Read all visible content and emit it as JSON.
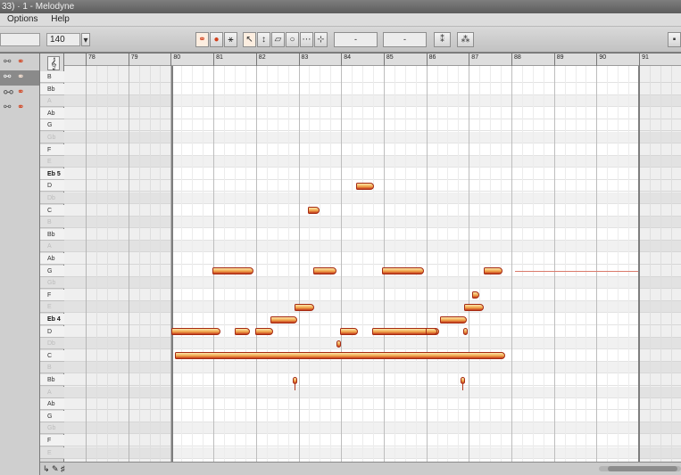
{
  "window": {
    "title": "33) · 1 - Melodyne"
  },
  "menu": {
    "items": [
      "Options",
      "Help"
    ]
  },
  "toolbar": {
    "tempo_value": "140",
    "tempo_step": "▾",
    "field_a": "-",
    "field_b": "-"
  },
  "sidebar": {
    "link_icon": "⚯",
    "note_icon": "⚭"
  },
  "piano_keys": [
    {
      "label": "B",
      "black": false,
      "bold": false
    },
    {
      "label": "Bb",
      "black": false,
      "bold": false
    },
    {
      "label": "A",
      "black": true,
      "bold": false
    },
    {
      "label": "Ab",
      "black": false,
      "bold": false
    },
    {
      "label": "G",
      "black": false,
      "bold": false
    },
    {
      "label": "Gb",
      "black": true,
      "bold": false
    },
    {
      "label": "F",
      "black": false,
      "bold": false
    },
    {
      "label": "E",
      "black": true,
      "bold": false
    },
    {
      "label": "Eb 5",
      "black": false,
      "bold": true
    },
    {
      "label": "D",
      "black": false,
      "bold": false
    },
    {
      "label": "Db",
      "black": true,
      "bold": false
    },
    {
      "label": "C",
      "black": false,
      "bold": false
    },
    {
      "label": "B",
      "black": true,
      "bold": false
    },
    {
      "label": "Bb",
      "black": false,
      "bold": false
    },
    {
      "label": "A",
      "black": true,
      "bold": false
    },
    {
      "label": "Ab",
      "black": false,
      "bold": false
    },
    {
      "label": "G",
      "black": false,
      "bold": false
    },
    {
      "label": "Gb",
      "black": true,
      "bold": false
    },
    {
      "label": "F",
      "black": false,
      "bold": false
    },
    {
      "label": "E",
      "black": true,
      "bold": false
    },
    {
      "label": "Eb 4",
      "black": false,
      "bold": true
    },
    {
      "label": "D",
      "black": false,
      "bold": false
    },
    {
      "label": "Db",
      "black": true,
      "bold": false
    },
    {
      "label": "C",
      "black": false,
      "bold": false
    },
    {
      "label": "B",
      "black": true,
      "bold": false
    },
    {
      "label": "Bb",
      "black": false,
      "bold": false
    },
    {
      "label": "A",
      "black": true,
      "bold": false
    },
    {
      "label": "Ab",
      "black": false,
      "bold": false
    },
    {
      "label": "G",
      "black": false,
      "bold": false
    },
    {
      "label": "Gb",
      "black": true,
      "bold": false
    },
    {
      "label": "F",
      "black": false,
      "bold": false
    },
    {
      "label": "E",
      "black": true,
      "bold": false
    }
  ],
  "ruler": {
    "bars": [
      "78",
      "79",
      "80",
      "81",
      "82",
      "83",
      "84",
      "85",
      "86",
      "87",
      "88",
      "89",
      "90",
      "91"
    ]
  },
  "clef_icon": "𝄞",
  "bottom_tools": [
    "↳",
    "✎",
    "♯"
  ],
  "accent": "#d2401c"
}
